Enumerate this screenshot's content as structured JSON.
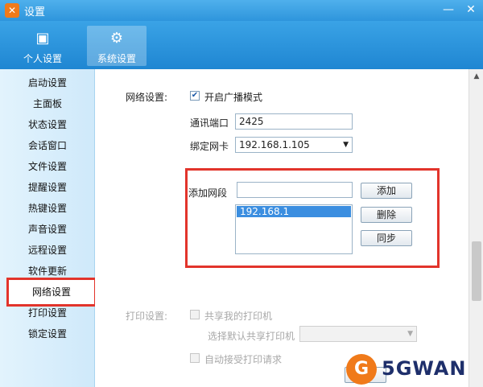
{
  "window": {
    "title": "设置",
    "min_icon": "minimize-icon",
    "close_icon": "close-icon"
  },
  "header": {
    "tabs": [
      {
        "label": "个人设置",
        "icon": "id-card-icon"
      },
      {
        "label": "系统设置",
        "icon": "gear-icon",
        "active": true
      }
    ]
  },
  "sidebar": {
    "items": [
      "启动设置",
      "主面板",
      "状态设置",
      "会话窗口",
      "文件设置",
      "提醒设置",
      "热键设置",
      "声音设置",
      "远程设置",
      "软件更新",
      "网络设置",
      "打印设置",
      "锁定设置"
    ],
    "selected": "网络设置"
  },
  "network": {
    "section_label": "网络设置:",
    "broadcast_label": "开启广播模式",
    "broadcast_checked": true,
    "port_label": "通讯端口",
    "port_value": "2425",
    "nic_label": "绑定网卡",
    "nic_value": "192.168.1.105",
    "add_segment_label": "添加网段",
    "add_segment_value": "",
    "segments": [
      "192.168.1"
    ],
    "add_button": "添加",
    "delete_button": "删除",
    "sync_button": "同步"
  },
  "print": {
    "section_label": "打印设置:",
    "share_printer_label": "共享我的打印机",
    "default_printer_label": "选择默认共享打印机",
    "auto_accept_label": "自动接受打印请求"
  },
  "footer": {
    "save_button": "保存"
  },
  "watermark": {
    "text": "5GWAN"
  },
  "colors": {
    "accent": "#2e95dc",
    "highlight": "#e2342b",
    "selection": "#3b8ee0"
  }
}
